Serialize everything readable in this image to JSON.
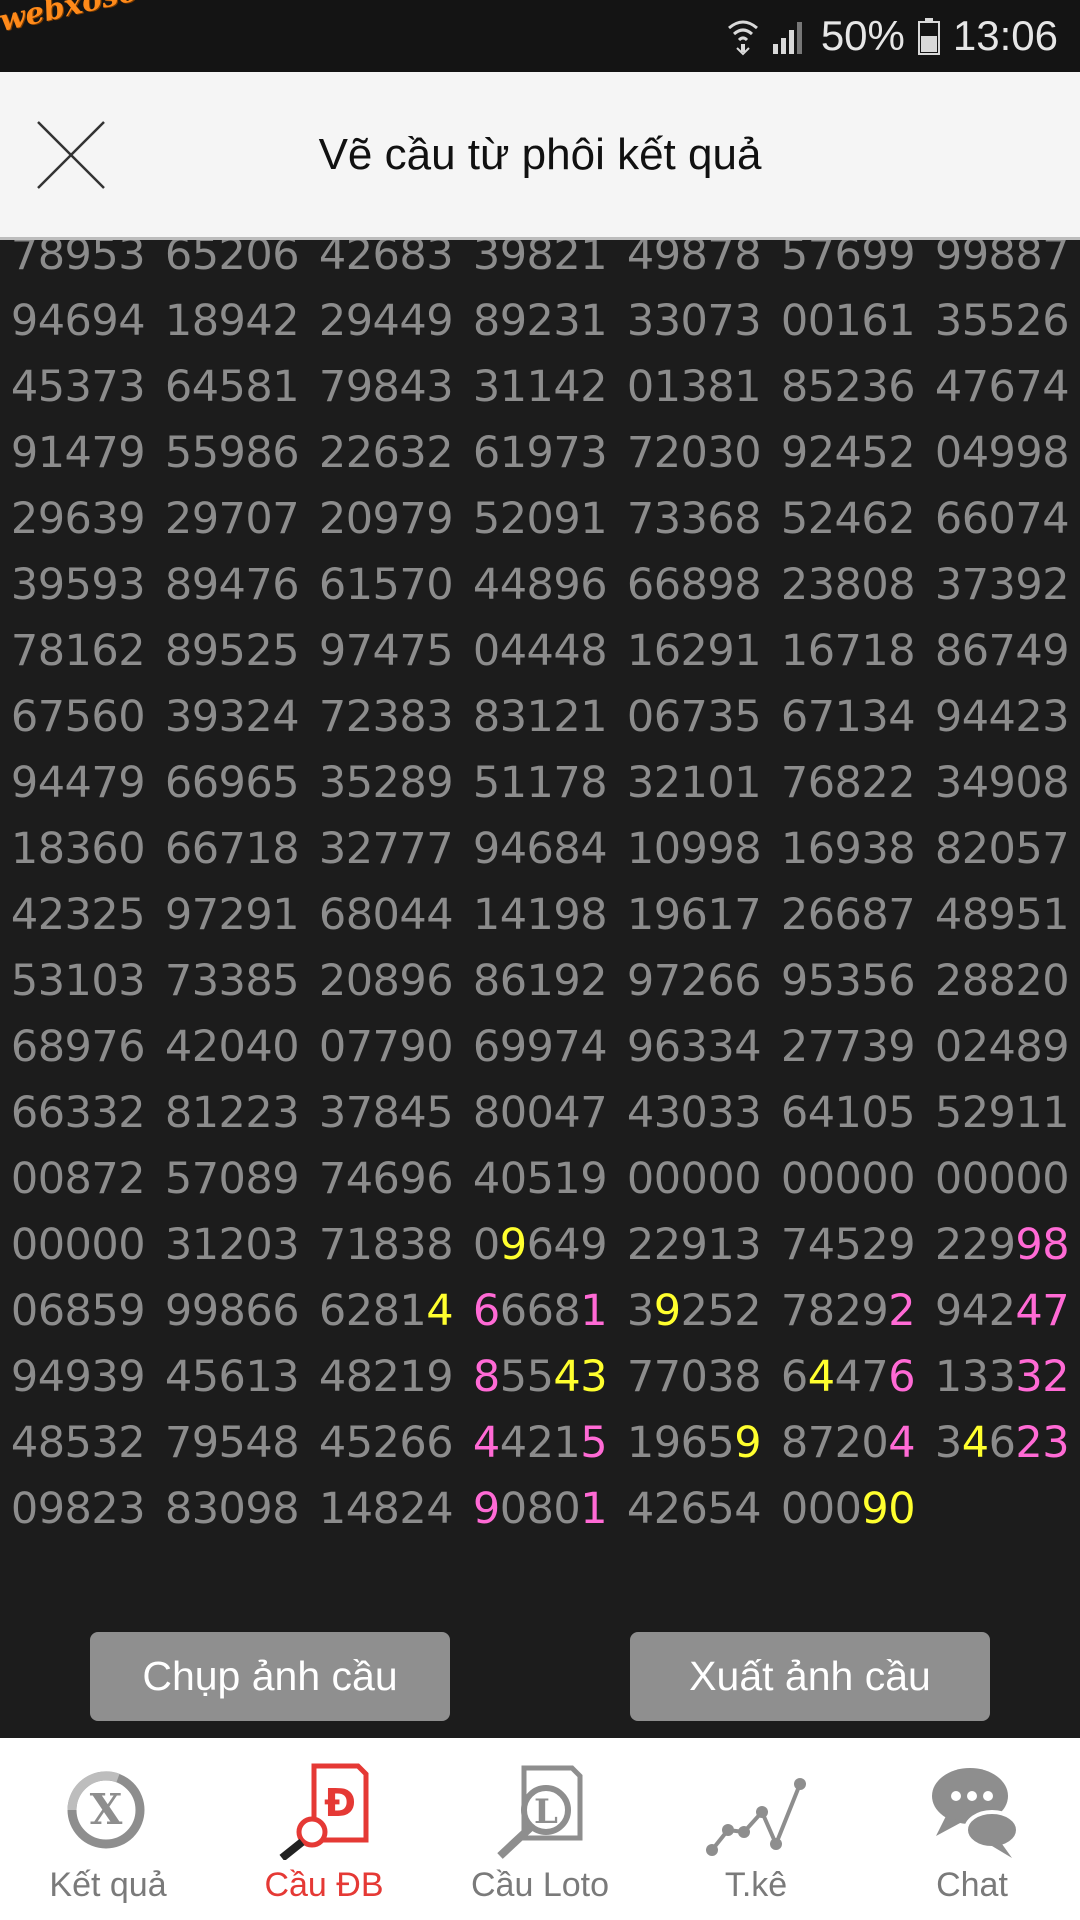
{
  "status_bar": {
    "watermark": "webxoso.net",
    "battery": "50%",
    "time": "13:06"
  },
  "header": {
    "title": "Vẽ cầu từ phôi kết quả",
    "close_icon": "close-icon"
  },
  "colors": {
    "number": "#8c8c8c",
    "highlight_yellow": "#ffff2e",
    "highlight_pink": "#ff6ad5",
    "active_tab": "#e53935",
    "button": "#8f8f8f"
  },
  "number_grid": [
    [
      "78953",
      "65206",
      "42683",
      "39821",
      "49878",
      "57699",
      "99887"
    ],
    [
      "94694",
      "18942",
      "29449",
      "89231",
      "33073",
      "00161",
      "35526"
    ],
    [
      "45373",
      "64581",
      "79843",
      "31142",
      "01381",
      "85236",
      "47674"
    ],
    [
      "91479",
      "55986",
      "22632",
      "61973",
      "72030",
      "92452",
      "04998"
    ],
    [
      "29639",
      "29707",
      "20979",
      "52091",
      "73368",
      "52462",
      "66074"
    ],
    [
      "39593",
      "89476",
      "61570",
      "44896",
      "66898",
      "23808",
      "37392"
    ],
    [
      "78162",
      "89525",
      "97475",
      "04448",
      "16291",
      "16718",
      "86749"
    ],
    [
      "67560",
      "39324",
      "72383",
      "83121",
      "06735",
      "67134",
      "94423"
    ],
    [
      "94479",
      "66965",
      "35289",
      "51178",
      "32101",
      "76822",
      "34908"
    ],
    [
      "18360",
      "66718",
      "32777",
      "94684",
      "10998",
      "16938",
      "82057"
    ],
    [
      "42325",
      "97291",
      "68044",
      "14198",
      "19617",
      "26687",
      "48951"
    ],
    [
      "53103",
      "73385",
      "20896",
      "86192",
      "97266",
      "95356",
      "28820"
    ],
    [
      "68976",
      "42040",
      "07790",
      "69974",
      "96334",
      "27739",
      "02489"
    ],
    [
      "66332",
      "81223",
      "37845",
      "80047",
      "43033",
      "64105",
      "52911"
    ],
    [
      "00872",
      "57089",
      "74696",
      "40519",
      "00000",
      "00000",
      "00000"
    ],
    [
      "00000",
      "31203",
      "71838",
      "09649",
      "22913",
      "74529",
      "22998"
    ],
    [
      "06859",
      "99866",
      "62814",
      "66681",
      "39252",
      "78292",
      "94247"
    ],
    [
      "94939",
      "45613",
      "48219",
      "85543",
      "77038",
      "64476",
      "13332"
    ],
    [
      "48532",
      "79548",
      "45266",
      "44215",
      "19659",
      "87204",
      "34623"
    ],
    [
      "09823",
      "83098",
      "14824",
      "90801",
      "42654",
      "00090",
      ""
    ]
  ],
  "highlights": [
    {
      "row": 15,
      "col": 3,
      "idx": 1,
      "color": "y"
    },
    {
      "row": 15,
      "col": 6,
      "idx": 3,
      "color": "p"
    },
    {
      "row": 15,
      "col": 6,
      "idx": 4,
      "color": "p"
    },
    {
      "row": 16,
      "col": 2,
      "idx": 4,
      "color": "y"
    },
    {
      "row": 16,
      "col": 3,
      "idx": 0,
      "color": "p"
    },
    {
      "row": 16,
      "col": 3,
      "idx": 4,
      "color": "p"
    },
    {
      "row": 16,
      "col": 4,
      "idx": 1,
      "color": "y"
    },
    {
      "row": 16,
      "col": 5,
      "idx": 4,
      "color": "p"
    },
    {
      "row": 16,
      "col": 6,
      "idx": 3,
      "color": "p"
    },
    {
      "row": 16,
      "col": 6,
      "idx": 4,
      "color": "p"
    },
    {
      "row": 17,
      "col": 3,
      "idx": 0,
      "color": "p"
    },
    {
      "row": 17,
      "col": 3,
      "idx": 3,
      "color": "y"
    },
    {
      "row": 17,
      "col": 3,
      "idx": 4,
      "color": "y"
    },
    {
      "row": 17,
      "col": 5,
      "idx": 1,
      "color": "y"
    },
    {
      "row": 17,
      "col": 5,
      "idx": 4,
      "color": "p"
    },
    {
      "row": 17,
      "col": 6,
      "idx": 3,
      "color": "p"
    },
    {
      "row": 17,
      "col": 6,
      "idx": 4,
      "color": "p"
    },
    {
      "row": 18,
      "col": 3,
      "idx": 0,
      "color": "p"
    },
    {
      "row": 18,
      "col": 3,
      "idx": 4,
      "color": "p"
    },
    {
      "row": 18,
      "col": 4,
      "idx": 4,
      "color": "y"
    },
    {
      "row": 18,
      "col": 5,
      "idx": 4,
      "color": "p"
    },
    {
      "row": 18,
      "col": 6,
      "idx": 1,
      "color": "y"
    },
    {
      "row": 18,
      "col": 6,
      "idx": 3,
      "color": "p"
    },
    {
      "row": 18,
      "col": 6,
      "idx": 4,
      "color": "p"
    },
    {
      "row": 19,
      "col": 3,
      "idx": 0,
      "color": "p"
    },
    {
      "row": 19,
      "col": 3,
      "idx": 4,
      "color": "p"
    },
    {
      "row": 19,
      "col": 5,
      "idx": 3,
      "color": "y"
    },
    {
      "row": 19,
      "col": 5,
      "idx": 4,
      "color": "y"
    }
  ],
  "buttons": {
    "capture": "Chụp ảnh cầu",
    "export": "Xuất ảnh cầu"
  },
  "bottom_nav": [
    {
      "label": "Kết quả",
      "icon": "result-x-icon",
      "active": false
    },
    {
      "label": "Cầu ĐB",
      "icon": "search-doc-d-icon",
      "active": true
    },
    {
      "label": "Cầu Loto",
      "icon": "search-doc-l-icon",
      "active": false
    },
    {
      "label": "T.kê",
      "icon": "line-chart-icon",
      "active": false
    },
    {
      "label": "Chat",
      "icon": "chat-bubbles-icon",
      "active": false
    }
  ]
}
